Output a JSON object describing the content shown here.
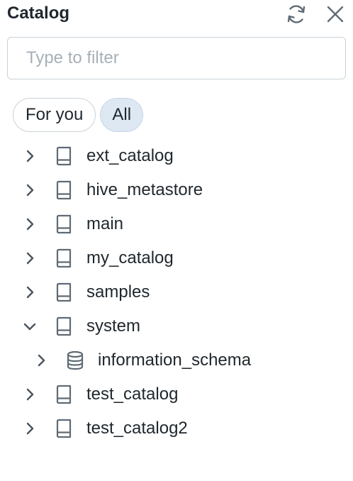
{
  "header": {
    "title": "Catalog",
    "refresh_icon": "refresh-icon",
    "close_icon": "close-icon"
  },
  "filter": {
    "placeholder": "Type to filter",
    "value": ""
  },
  "chips": [
    {
      "label": "For you",
      "selected": false
    },
    {
      "label": "All",
      "selected": true
    }
  ],
  "tree": [
    {
      "label": "ext_catalog",
      "icon": "book-icon",
      "expanded": false,
      "level": 0
    },
    {
      "label": "hive_metastore",
      "icon": "book-icon",
      "expanded": false,
      "level": 0
    },
    {
      "label": "main",
      "icon": "book-icon",
      "expanded": false,
      "level": 0
    },
    {
      "label": "my_catalog",
      "icon": "book-icon",
      "expanded": false,
      "level": 0
    },
    {
      "label": "samples",
      "icon": "book-icon",
      "expanded": false,
      "level": 0
    },
    {
      "label": "system",
      "icon": "book-icon",
      "expanded": true,
      "level": 0
    },
    {
      "label": "information_schema",
      "icon": "database-icon",
      "expanded": false,
      "level": 1
    },
    {
      "label": "test_catalog",
      "icon": "book-icon",
      "expanded": false,
      "level": 0
    },
    {
      "label": "test_catalog2",
      "icon": "book-icon",
      "expanded": false,
      "level": 0
    }
  ],
  "colors": {
    "text": "#1f272d",
    "icon": "#5f6b75",
    "border": "#c9d2d8",
    "active_chip_bg": "#dde8f3",
    "placeholder": "#a7b0b7"
  }
}
